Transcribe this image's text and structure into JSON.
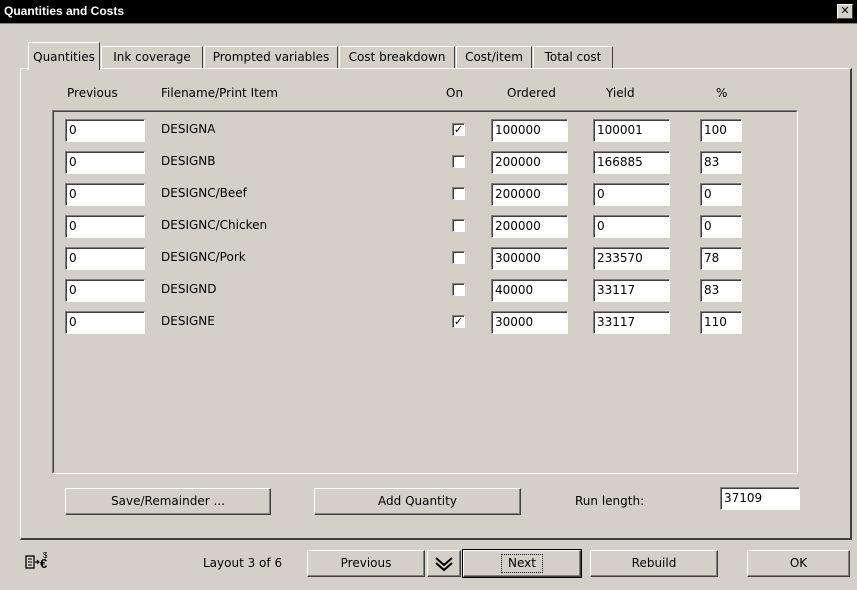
{
  "window": {
    "title": "Quantities and Costs",
    "close_glyph": "✕"
  },
  "tabs": [
    {
      "label": "Quantities",
      "active": true
    },
    {
      "label": "Ink coverage"
    },
    {
      "label": "Prompted variables"
    },
    {
      "label": "Cost breakdown"
    },
    {
      "label": "Cost/item"
    },
    {
      "label": "Total cost"
    }
  ],
  "columns": {
    "previous": "Previous",
    "filename": "Filename/Print Item",
    "on": "On",
    "ordered": "Ordered",
    "yield": "Yield",
    "percent": "%"
  },
  "rows": [
    {
      "previous": "0",
      "name": "DESIGNA",
      "on": true,
      "ordered": "100000",
      "yield": "100001",
      "percent": "100"
    },
    {
      "previous": "0",
      "name": "DESIGNB",
      "on": false,
      "ordered": "200000",
      "yield": "166885",
      "percent": "83"
    },
    {
      "previous": "0",
      "name": "DESIGNC/Beef",
      "on": false,
      "ordered": "200000",
      "yield": "0",
      "percent": "0"
    },
    {
      "previous": "0",
      "name": "DESIGNC/Chicken",
      "on": false,
      "ordered": "200000",
      "yield": "0",
      "percent": "0"
    },
    {
      "previous": "0",
      "name": "DESIGNC/Pork",
      "on": false,
      "ordered": "300000",
      "yield": "233570",
      "percent": "78"
    },
    {
      "previous": "0",
      "name": "DESIGND",
      "on": false,
      "ordered": "40000",
      "yield": "33117",
      "percent": "83"
    },
    {
      "previous": "0",
      "name": "DESIGNE",
      "on": true,
      "ordered": "30000",
      "yield": "33117",
      "percent": "110"
    }
  ],
  "actions": {
    "save_remainder": "Save/Remainder ...",
    "add_quantity": "Add Quantity",
    "run_length_label": "Run length:",
    "run_length_value": "37109"
  },
  "footer": {
    "layout_status": "Layout 3 of 6",
    "previous": "Previous",
    "next": "Next",
    "rebuild": "Rebuild",
    "ok": "OK",
    "cost_icon": "cost-calculator-icon",
    "expand_icon": "double-chevron-down-icon"
  }
}
